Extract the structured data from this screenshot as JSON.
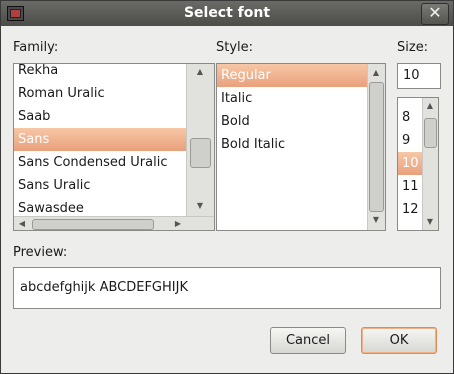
{
  "window": {
    "title": "Select font",
    "close_glyph": "✕"
  },
  "family": {
    "label": "Family:",
    "items": [
      {
        "label": "Rekha"
      },
      {
        "label": "Roman Uralic"
      },
      {
        "label": "Saab"
      },
      {
        "label": "Sans",
        "selected": true
      },
      {
        "label": "Sans Condensed Uralic"
      },
      {
        "label": "Sans Uralic"
      },
      {
        "label": "Sawasdee"
      }
    ]
  },
  "style": {
    "label": "Style:",
    "items": [
      {
        "label": "Regular",
        "selected": true
      },
      {
        "label": "Italic"
      },
      {
        "label": "Bold"
      },
      {
        "label": "Bold Italic"
      }
    ]
  },
  "size": {
    "label": "Size:",
    "value": "10",
    "items": [
      {
        "label": "8"
      },
      {
        "label": "9"
      },
      {
        "label": "10",
        "selected": true
      },
      {
        "label": "11"
      },
      {
        "label": "12"
      }
    ]
  },
  "preview": {
    "label": "Preview:",
    "text": "abcdefghijk ABCDEFGHIJK"
  },
  "buttons": {
    "cancel": "Cancel",
    "ok": "OK"
  },
  "colors": {
    "selection": "#eaa07c",
    "titlebar": "#4c4c48",
    "dialog_bg": "#ededeb"
  }
}
